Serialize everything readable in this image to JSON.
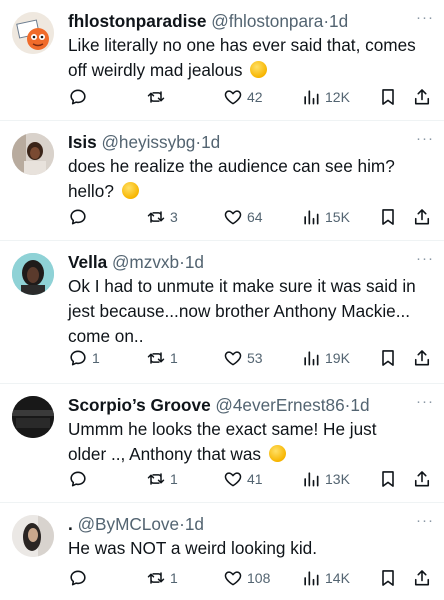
{
  "tweets": [
    {
      "name": "fhlostonparadise",
      "handle": "@fhlostonpara",
      "time": "1d",
      "lines": [
        "Like literally no one has ever said that, comes",
        "off weirdly mad jealous"
      ],
      "emoji": "smirk-emoji",
      "replies": "",
      "retweets": "",
      "likes": "42",
      "views": "12K"
    },
    {
      "name": "Isis",
      "handle": "@heyissybg",
      "time": "1d",
      "lines": [
        "does he realize the audience can see him?",
        "hello?"
      ],
      "emoji": "crying-emoji",
      "replies": "",
      "retweets": "3",
      "likes": "64",
      "views": "15K"
    },
    {
      "name": "Vella",
      "handle": "@mzvxb",
      "time": "1d",
      "lines": [
        "Ok I had to unmute it make sure it was said in",
        "jest because...now brother Anthony Mackie...",
        "come on.."
      ],
      "emoji": "",
      "replies": "1",
      "retweets": "1",
      "likes": "53",
      "views": "19K"
    },
    {
      "name": "Scorpio’s Groove",
      "handle": "@4everErnest86",
      "time": "1d",
      "lines": [
        "Ummm he looks the exact same! He just",
        "older .., Anthony that was"
      ],
      "emoji": "smirk-emoji",
      "replies": "",
      "retweets": "1",
      "likes": "41",
      "views": "13K"
    },
    {
      "name": ".",
      "handle": "@ByMCLove",
      "time": "1d",
      "lines": [
        "He was NOT a weird looking kid."
      ],
      "emoji": "",
      "replies": "",
      "retweets": "1",
      "likes": "108",
      "views": "14K"
    }
  ],
  "separator": "·",
  "more_glyph": "···",
  "colors": {
    "text": "#0f1419",
    "secondary": "#536471",
    "divider": "#eff3f4",
    "background": "#ffffff"
  },
  "icons": [
    "reply-icon",
    "retweet-icon",
    "like-icon",
    "views-icon",
    "bookmark-icon",
    "share-icon"
  ]
}
